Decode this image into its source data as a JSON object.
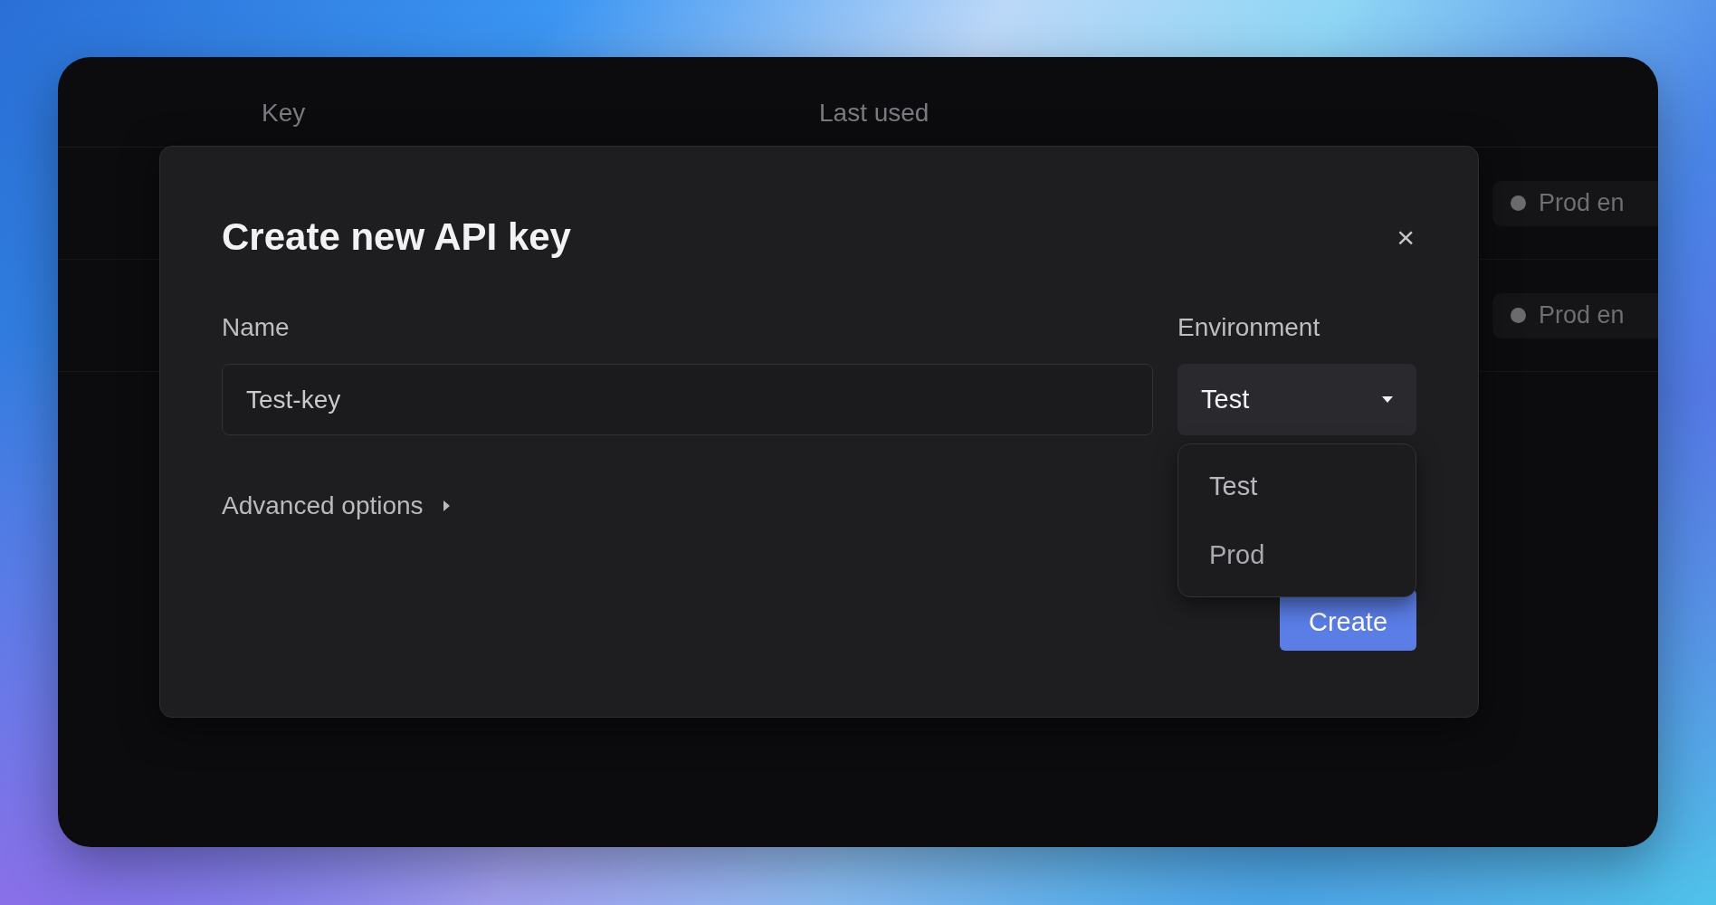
{
  "table": {
    "columns": [
      "Key",
      "Last used"
    ],
    "rows": [
      {
        "environment": "Prod en"
      },
      {
        "environment": "Prod en"
      }
    ]
  },
  "dialog": {
    "title": "Create new API key",
    "close": "×",
    "name_field": {
      "label": "Name",
      "value": "Test-key"
    },
    "environment_field": {
      "label": "Environment",
      "value": "Test",
      "expanded": true,
      "options": [
        "Test",
        "Prod"
      ]
    },
    "advanced_options": {
      "label": "Advanced options",
      "expanded": false
    },
    "primary_button": "Create"
  }
}
